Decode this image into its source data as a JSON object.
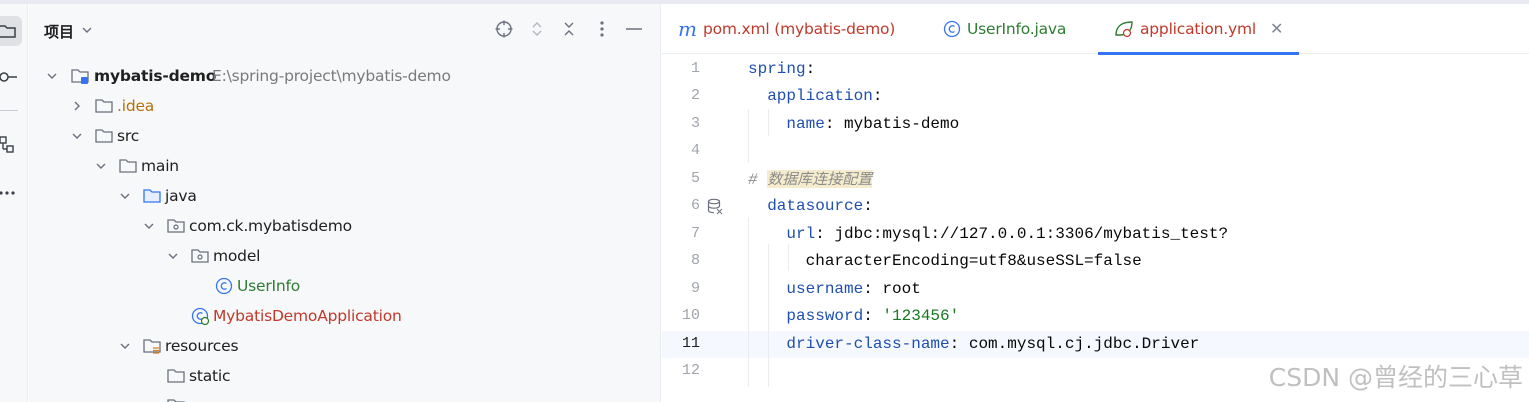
{
  "project_panel": {
    "title": "项目",
    "tree": [
      {
        "label": "mybatis-demo",
        "path": "E:\\spring-project\\mybatis-demo"
      },
      {
        "label": ".idea"
      },
      {
        "label": "src"
      },
      {
        "label": "main"
      },
      {
        "label": "java"
      },
      {
        "label": "com.ck.mybatisdemo"
      },
      {
        "label": "model"
      },
      {
        "label": "UserInfo"
      },
      {
        "label": "MybatisDemoApplication"
      },
      {
        "label": "resources"
      },
      {
        "label": "static"
      }
    ]
  },
  "tabs": [
    {
      "label": "pom.xml (mybatis-demo)",
      "icon": "maven-icon",
      "color": "#c0392b"
    },
    {
      "label": "UserInfo.java",
      "icon": "class-icon",
      "color": "#2e7d32"
    },
    {
      "label": "application.yml",
      "icon": "spring-icon",
      "color": "#c0392b",
      "active": true
    }
  ],
  "editor": {
    "line_numbers": [
      "1",
      "2",
      "3",
      "4",
      "5",
      "6",
      "7",
      "",
      "8",
      "9",
      "10",
      "11",
      "12"
    ],
    "lines": {
      "l1_key": "spring",
      "l2_key": "application",
      "l3_key": "name",
      "l3_val": "mybatis-demo",
      "l5_hash": "#",
      "l5_comment": "数据库连接配置",
      "l6_key": "datasource",
      "l7_key": "url",
      "l7_val": "jdbc:mysql://127.0.0.1:3306/mybatis_test?",
      "l7_cont": "characterEncoding=utf8&useSSL=false",
      "l9_key": "username",
      "l9_val": "root",
      "l10_key": "password",
      "l10_val": "'123456'",
      "l11_key": "driver-class-name",
      "l11_val": "com.mysql.cj.jdbc.Driver"
    }
  },
  "watermark": "CSDN @曾经的三心草",
  "colors": {
    "accent": "#3574f0",
    "yaml_key": "#1f4fb0",
    "yaml_string": "#16791f",
    "comment": "#8c8c8c"
  }
}
